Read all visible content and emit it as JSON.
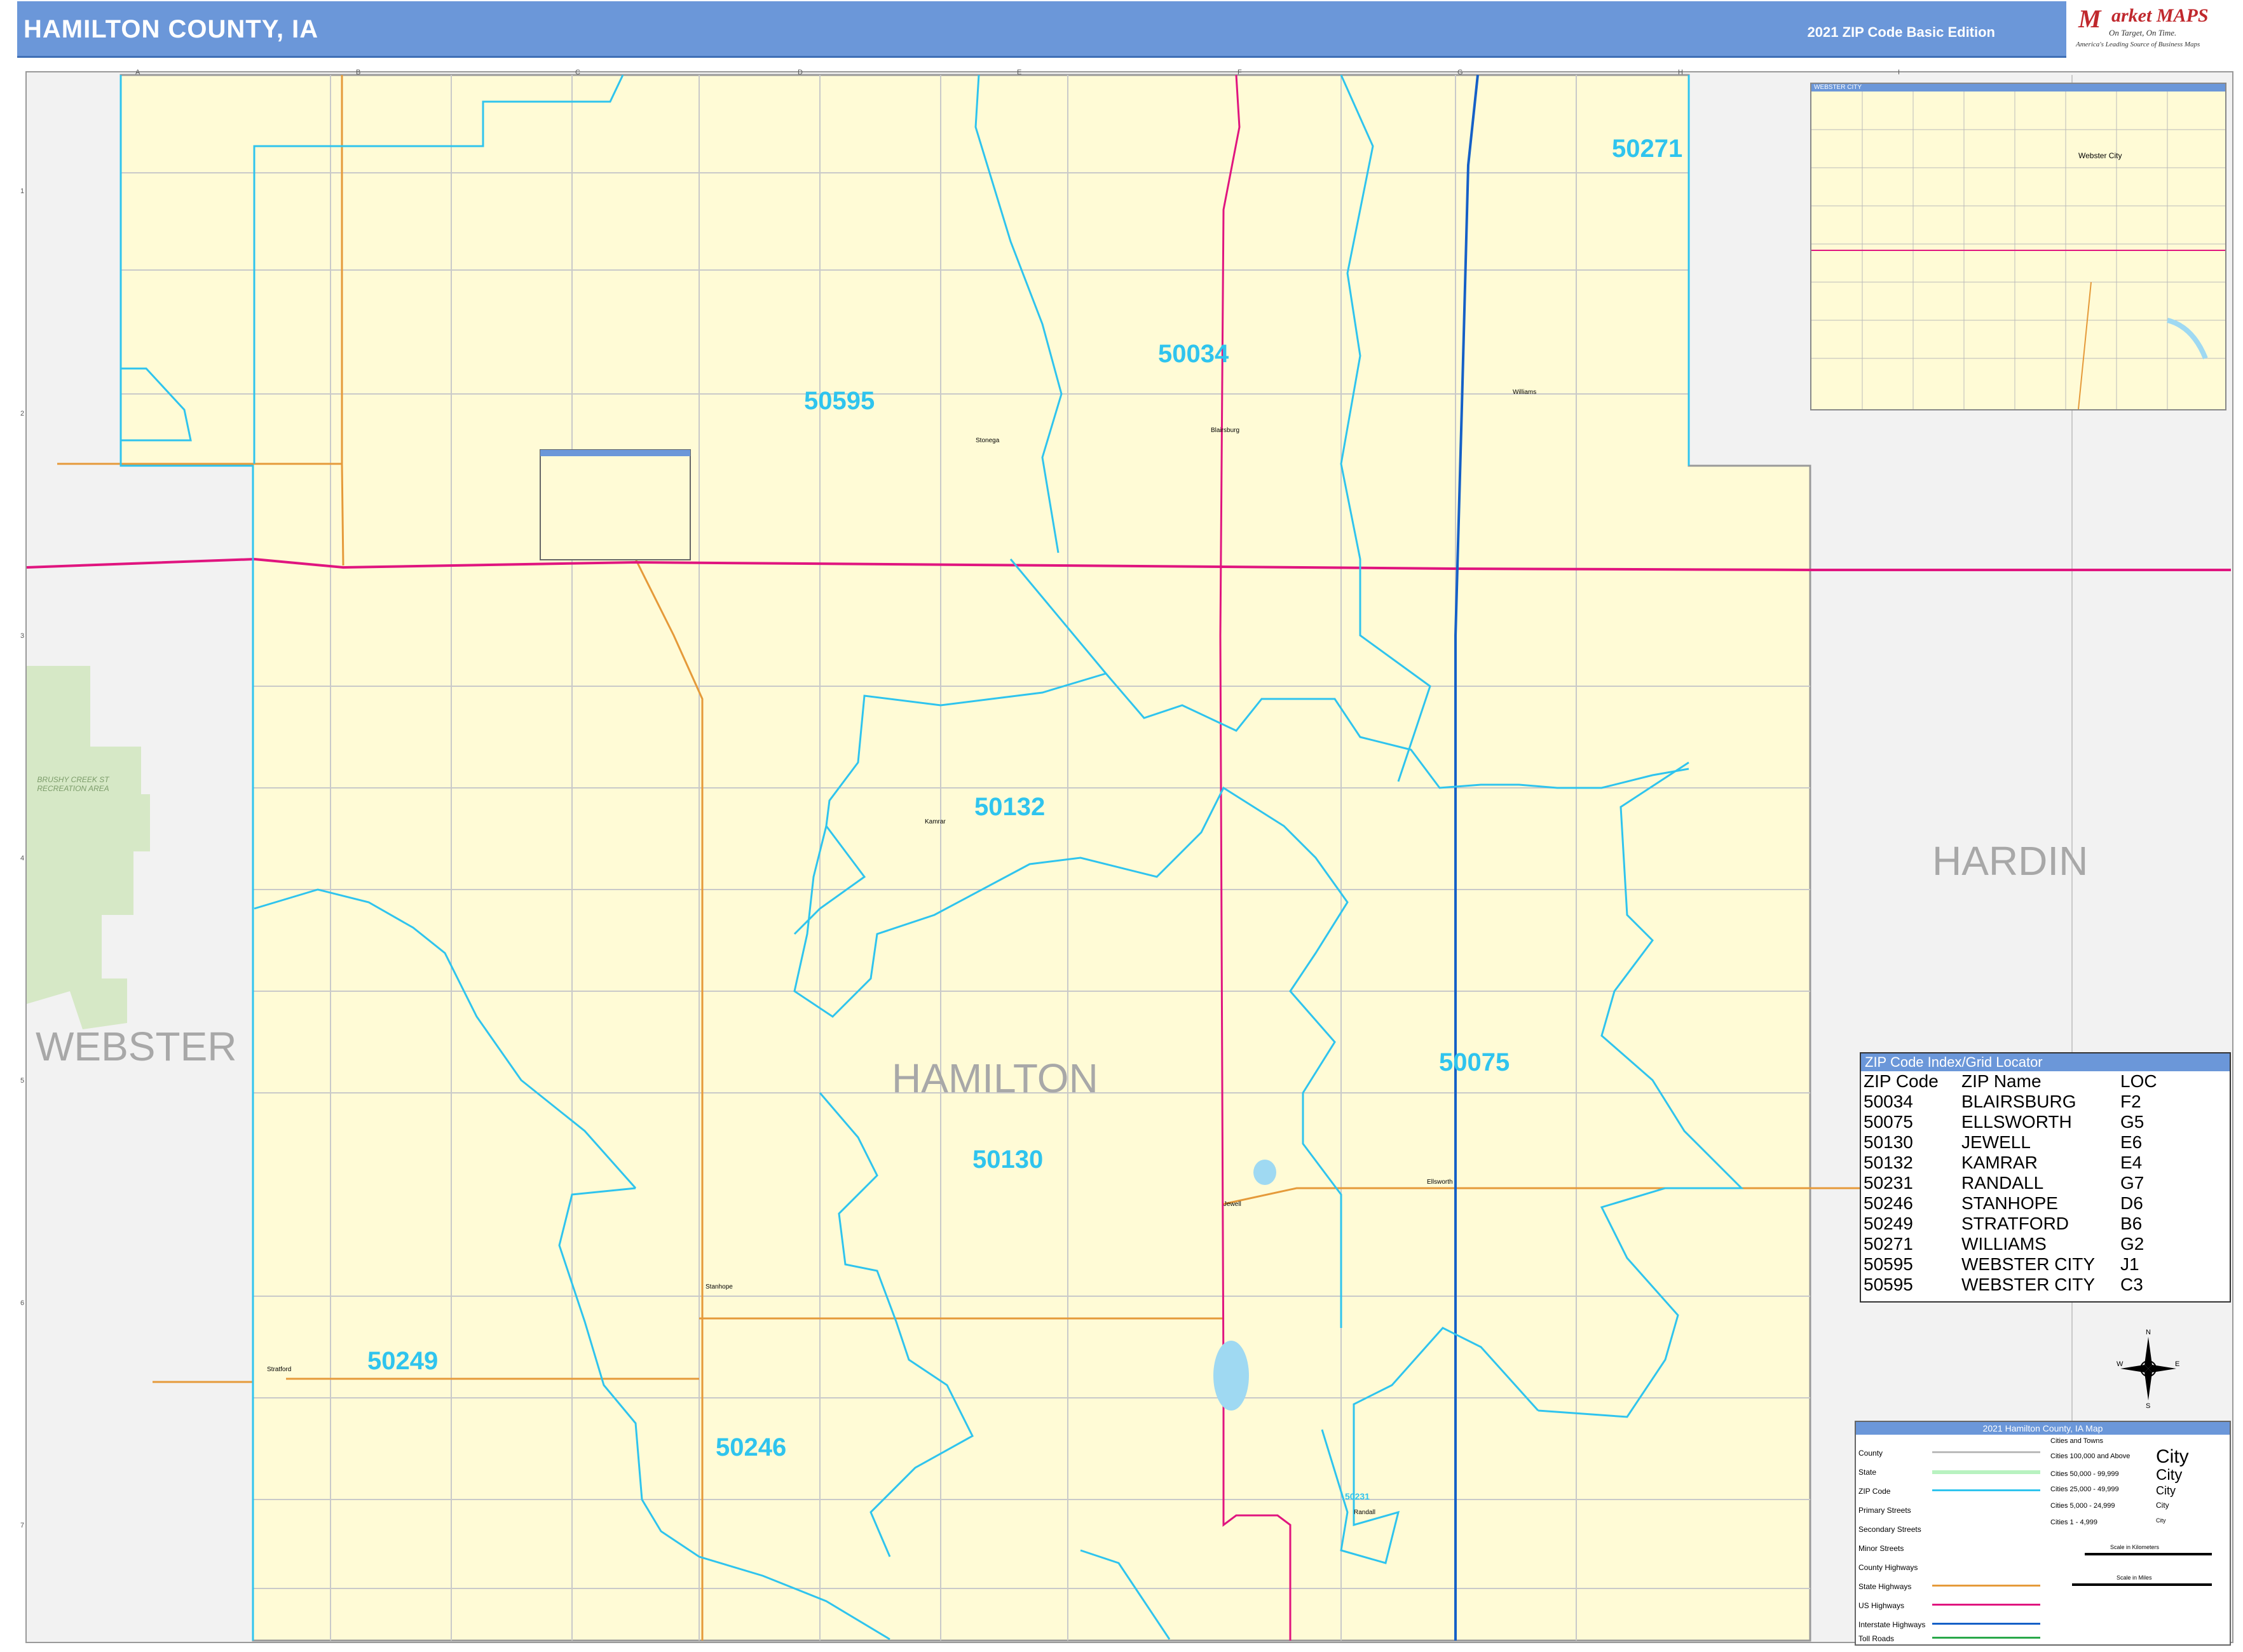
{
  "header": {
    "title": "HAMILTON COUNTY, IA",
    "edition": "2021 ZIP Code Basic Edition"
  },
  "logo": {
    "mark": "M",
    "name": "arket MAPS",
    "sub": "On Target, On Time.",
    "tagline": "America's Leading Source of Business Maps"
  },
  "counties": {
    "center": "HAMILTON",
    "west": "WEBSTER",
    "east": "HARDIN"
  },
  "park_label": "BRUSHY CREEK ST RECREATION AREA",
  "zip_labels": [
    "50271",
    "50034",
    "50595",
    "50132",
    "50075",
    "50130",
    "50249",
    "50246",
    "50231"
  ],
  "places": [
    "Webster City",
    "Blairsburg",
    "Williams",
    "Kamrar",
    "Jewell",
    "Ellsworth",
    "Stanhope",
    "Stratford",
    "Randall",
    "Stonega"
  ],
  "inset": {
    "title": "WEBSTER CITY",
    "place": "Webster City"
  },
  "zip_index": {
    "title": "ZIP Code Index/Grid Locator",
    "headers": [
      "ZIP Code",
      "ZIP Name",
      "LOC"
    ],
    "rows": [
      [
        "50034",
        "BLAIRSBURG",
        "F2"
      ],
      [
        "50075",
        "ELLSWORTH",
        "G5"
      ],
      [
        "50130",
        "JEWELL",
        "E6"
      ],
      [
        "50132",
        "KAMRAR",
        "E4"
      ],
      [
        "50231",
        "RANDALL",
        "G7"
      ],
      [
        "50246",
        "STANHOPE",
        "D6"
      ],
      [
        "50249",
        "STRATFORD",
        "B6"
      ],
      [
        "50271",
        "WILLIAMS",
        "G2"
      ],
      [
        "50595",
        "WEBSTER CITY",
        "J1"
      ],
      [
        "50595",
        "WEBSTER CITY",
        "C3"
      ]
    ]
  },
  "legend": {
    "title": "2021 Hamilton County, IA Map",
    "items": [
      "County",
      "State",
      "ZIP Code",
      "Primary Streets",
      "Secondary Streets",
      "Minor Streets",
      "County Highways",
      "State Highways",
      "US Highways",
      "Interstate Highways",
      "Toll Roads"
    ],
    "city_header": "Cities and Towns",
    "cities": [
      "Cities 100,000 and Above",
      "Cities 50,000 - 99,999",
      "Cities 25,000 - 49,999",
      "Cities 5,000 - 24,999",
      "Cities 1 - 4,999"
    ],
    "city_sample": "City",
    "scale_km": "Scale in Kilometers",
    "scale_mi": "Scale in Miles"
  },
  "compass": [
    "N",
    "E",
    "S",
    "W"
  ],
  "grid_cols": [
    "A",
    "B",
    "C",
    "D",
    "E",
    "F",
    "G",
    "H",
    "I"
  ],
  "grid_rows": [
    "1",
    "2",
    "3",
    "4",
    "5",
    "6",
    "7"
  ],
  "colors": {
    "header": "#6b97d9",
    "county_fill": "#fffbd6",
    "zip_line": "#2fc4ee",
    "us_highway": "#e0157f",
    "interstate": "#1560c7",
    "state_highway": "#e59a3a",
    "park": "#d6e8c6"
  }
}
